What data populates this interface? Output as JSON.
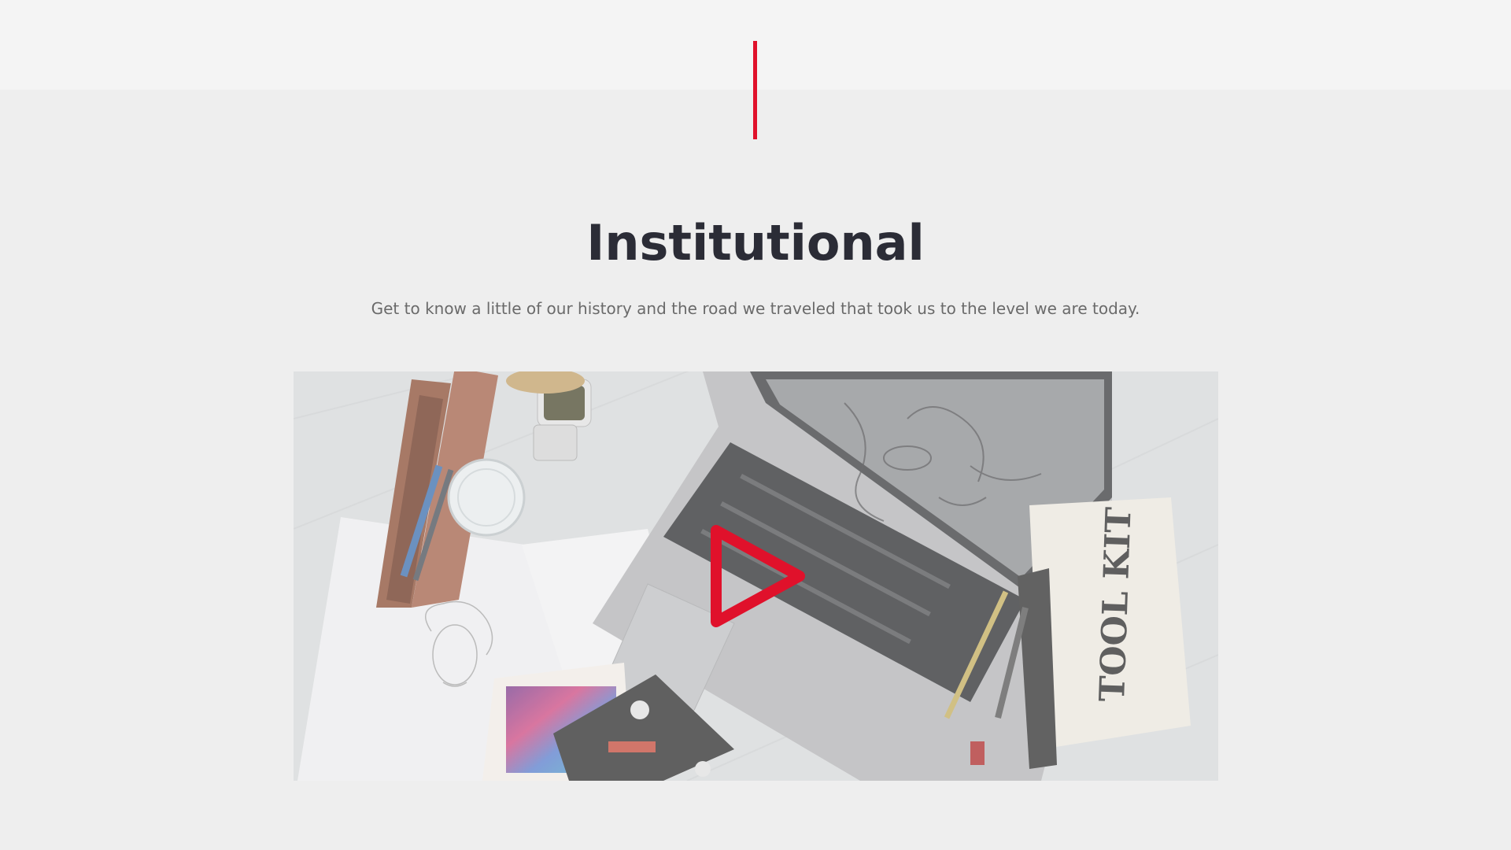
{
  "section": {
    "title": "Institutional",
    "subtitle": "Get to know a little of our history and the road we traveled that took us to the level we are today."
  },
  "video": {
    "pouch_text": "TOOL KIT",
    "play_icon": "play-icon"
  },
  "colors": {
    "accent": "#e0112b",
    "heading": "#2b2c36",
    "text": "#6a6a6a",
    "background": "#eeeeee"
  }
}
